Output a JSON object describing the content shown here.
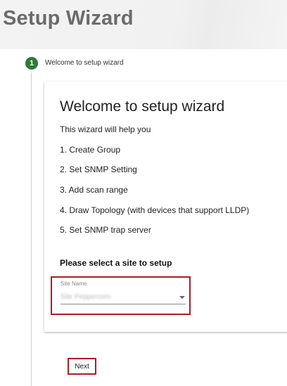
{
  "header": {
    "title": "Setup Wizard"
  },
  "stepper": {
    "step_number": "1",
    "step_label": "Welcome to setup wizard"
  },
  "card": {
    "title": "Welcome to setup wizard",
    "intro": "This wizard will help you",
    "items": [
      "1. Create Group",
      "2. Set SNMP Setting",
      "3. Add scan range",
      "4. Draw Topology (with devices that support LLDP)",
      "5. Set SNMP trap server"
    ],
    "select_prompt": "Please select a site to setup",
    "site_field": {
      "label": "Site Name",
      "value": "Site Peppercorn"
    }
  },
  "actions": {
    "next_label": "Next"
  },
  "colors": {
    "step_active": "#2b7a3d",
    "highlight_border": "#b01c22"
  }
}
